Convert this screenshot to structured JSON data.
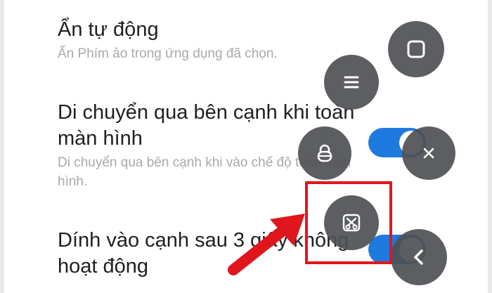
{
  "settings": [
    {
      "title": "Ẩn tự động",
      "description": "Ẩn Phím ảo trong ứng dụng đã chọn."
    },
    {
      "title": "Di chuyển qua bên cạnh khi toàn màn hình",
      "description": "Di chuyển qua bên cạnh khi vào chế độ toàn màn hình.",
      "toggle_on": true
    },
    {
      "title": "Dính vào cạnh sau 3 giây không hoạt động",
      "toggle_on": true
    }
  ],
  "floating_menu": {
    "buttons": [
      {
        "icon": "square-icon"
      },
      {
        "icon": "menu-icon"
      },
      {
        "icon": "lock-icon"
      },
      {
        "icon": "close-icon"
      },
      {
        "icon": "screenshot-icon"
      },
      {
        "icon": "back-icon"
      }
    ]
  },
  "colors": {
    "toggle_accent": "#1f7ae0",
    "fab_background": "#4e5054",
    "highlight": "#e0161c",
    "title_text": "#1f1f1f",
    "description_text": "#a9a9a9"
  }
}
